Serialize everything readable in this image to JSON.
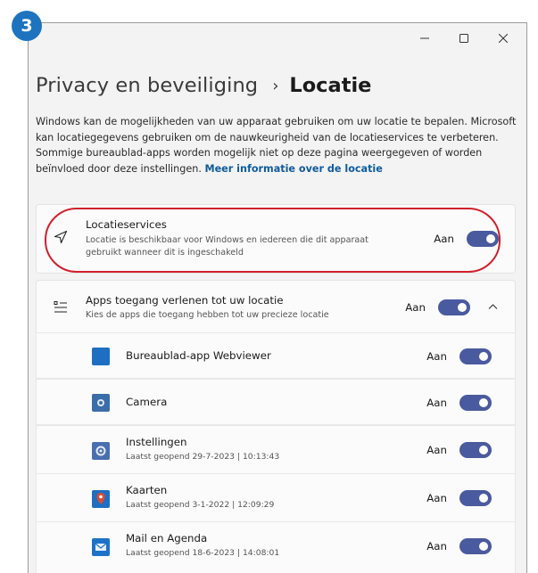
{
  "step": "3",
  "header": {
    "parent": "Privacy en beveiliging",
    "separator": "›",
    "current": "Locatie"
  },
  "description": {
    "text": "Windows kan de mogelijkheden van uw apparaat gebruiken om uw locatie te bepalen. Microsoft kan locatiegegevens gebruiken om de nauwkeurigheid van de locatieservices te verbeteren. Sommige bureaublad-apps worden mogelijk niet op deze pagina weergegeven of worden beïnvloed door deze instellingen.",
    "link": "Meer informatie over de locatie"
  },
  "location_services": {
    "title": "Locatieservices",
    "subtitle": "Locatie is beschikbaar voor Windows en iedereen die dit apparaat gebruikt wanneer dit is ingeschakeld",
    "state_label": "Aan",
    "on": true,
    "icon": "location-arrow-icon"
  },
  "apps_access": {
    "title": "Apps toegang verlenen tot uw locatie",
    "subtitle": "Kies de apps die toegang hebben tot uw precieze locatie",
    "state_label": "Aan",
    "on": true,
    "icon": "list-icon"
  },
  "apps": [
    {
      "name": "Bureaublad-app Webviewer",
      "last_opened": "",
      "state_label": "Aan",
      "on": true,
      "icon": "webviewer-icon",
      "color": "#1e6fc1"
    },
    {
      "name": "Camera",
      "last_opened": "",
      "state_label": "Aan",
      "on": true,
      "icon": "camera-icon",
      "color": "#3b6ea9"
    },
    {
      "name": "Instellingen",
      "last_opened": "Laatst geopend 29-7-2023  |  10:13:43",
      "state_label": "Aan",
      "on": true,
      "icon": "settings-gear-icon",
      "color": "#4a6fb0"
    },
    {
      "name": "Kaarten",
      "last_opened": "Laatst geopend 3-1-2022  |  12:09:29",
      "state_label": "Aan",
      "on": true,
      "icon": "maps-pin-icon",
      "color": "#1e6fc1"
    },
    {
      "name": "Mail en Agenda",
      "last_opened": "Laatst geopend 18-6-2023  |  14:08:01",
      "state_label": "Aan",
      "on": true,
      "icon": "mail-icon",
      "color": "#1d72c8"
    }
  ],
  "colors": {
    "toggle_on": "#4a5a9e",
    "link": "#0f5b9c",
    "highlight": "#d0202c",
    "badge": "#1e73be"
  }
}
